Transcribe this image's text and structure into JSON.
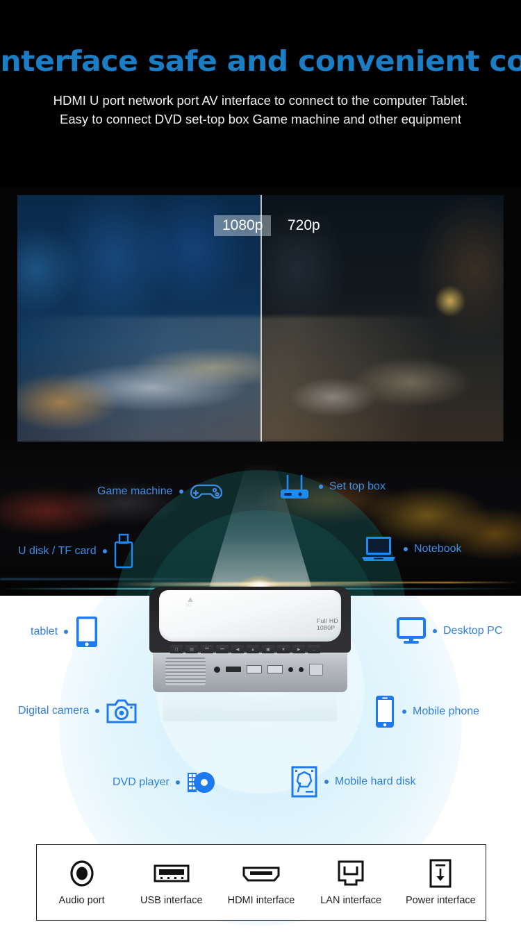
{
  "header": {
    "title": "Interface safe and convenient connection",
    "subtitle_line1": "HDMI U port network port AV interface to connect to the computer Tablet.",
    "subtitle_line2": "Easy to connect DVD set-top box Game machine and other equipment",
    "title_color": "#1b7ec4",
    "subtitle_color": "#f2f2f2"
  },
  "comparison": {
    "left_badge": "1080p",
    "right_badge": "720p"
  },
  "device": {
    "brand_text_line1": "Full HD",
    "brand_text_line2": "1080P"
  },
  "connections": {
    "dark_label_color": "#3e8ee6",
    "light_label_color": "#2f7fe0",
    "items": [
      {
        "label": "Game machine",
        "icon": "gamepad-icon"
      },
      {
        "label": "Set top box",
        "icon": "router-icon"
      },
      {
        "label": "U disk / TF card",
        "icon": "usb-flash-drive-icon"
      },
      {
        "label": "Notebook",
        "icon": "laptop-icon"
      },
      {
        "label": "tablet",
        "icon": "tablet-icon"
      },
      {
        "label": "Desktop PC",
        "icon": "monitor-icon"
      },
      {
        "label": "Digital camera",
        "icon": "camera-icon"
      },
      {
        "label": "Mobile phone",
        "icon": "smartphone-icon"
      },
      {
        "label": "DVD player",
        "icon": "dvd-disc-icon"
      },
      {
        "label": "Mobile hard disk",
        "icon": "hard-disk-icon"
      }
    ]
  },
  "ports": {
    "items": [
      {
        "label": "Audio port",
        "icon": "audio-jack-icon"
      },
      {
        "label": "USB interface",
        "icon": "usb-port-icon"
      },
      {
        "label": "HDMI interface",
        "icon": "hdmi-port-icon"
      },
      {
        "label": "LAN interface",
        "icon": "lan-rj45-icon"
      },
      {
        "label": "Power interface",
        "icon": "power-socket-icon"
      }
    ]
  }
}
